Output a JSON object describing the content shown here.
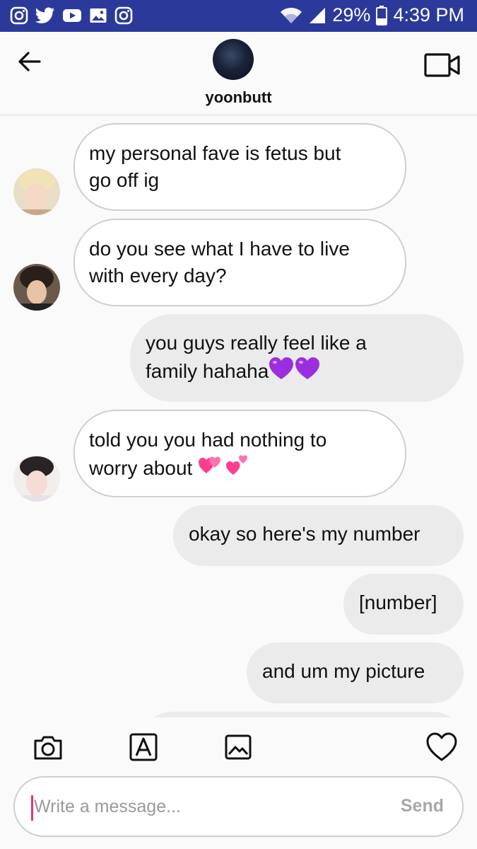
{
  "status_bar": {
    "battery": "29%",
    "time": "4:39 PM",
    "left_icons": [
      "instagram-icon",
      "twitter-icon",
      "youtube-icon",
      "gallery-icon",
      "instagram-icon"
    ],
    "right_icons": [
      "wifi-icon",
      "signal-icon",
      "battery-icon"
    ]
  },
  "header": {
    "username": "yoonbutt",
    "back_icon": "arrow-left-icon",
    "video_icon": "video-camera-icon"
  },
  "messages": [
    {
      "direction": "incoming",
      "lines": [
        "my personal fave is fetus but",
        "go off ig"
      ]
    },
    {
      "direction": "incoming",
      "lines": [
        "do you see what I have to live",
        "with every day?"
      ]
    },
    {
      "direction": "outgoing",
      "lines": [
        "you guys really feel like a",
        "family hahaha"
      ],
      "emoji": "💜💜"
    },
    {
      "direction": "incoming",
      "lines": [
        "told you you had nothing to",
        "worry about"
      ],
      "emoji": "💞💕"
    },
    {
      "direction": "outgoing",
      "lines": [
        "okay so here's my number"
      ]
    },
    {
      "direction": "outgoing",
      "lines": [
        "[number]"
      ]
    },
    {
      "direction": "outgoing",
      "lines": [
        "and um my picture"
      ]
    }
  ],
  "composer": {
    "placeholder": "Write a message...",
    "send_label": "Send",
    "tools": [
      "camera-icon",
      "text-format-icon",
      "image-icon",
      "heart-icon"
    ]
  },
  "colors": {
    "status_bar": "#2b3a9a",
    "incoming_bubble": "#ffffff",
    "outgoing_bubble": "#ebebeb",
    "caret": "#e6356b",
    "emoji_purple": "#9b2fe0",
    "emoji_pink": "#ff3d8f"
  }
}
